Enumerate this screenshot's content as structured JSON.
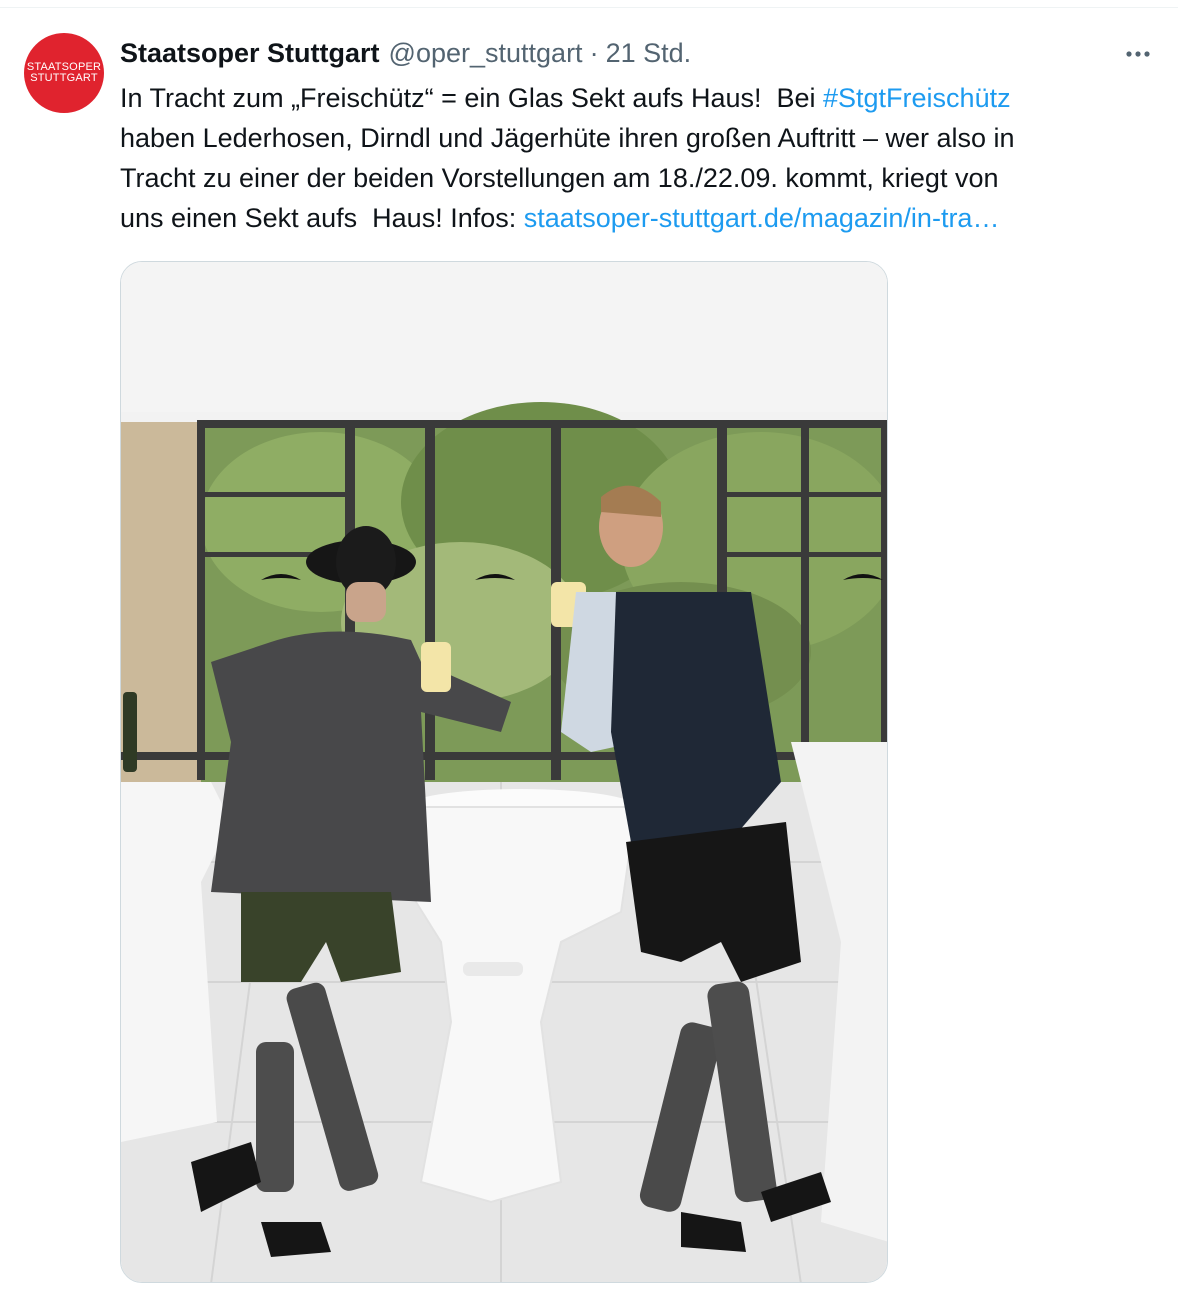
{
  "tweet": {
    "author_name": "Staatsoper Stuttgart",
    "handle": "@oper_stuttgart",
    "separator": "·",
    "time": "21 Std.",
    "more_icon": "more-horizontal-icon",
    "avatar": {
      "line1": "STAATSOPER",
      "line2": "STUTTGART",
      "color": "#e0232e"
    },
    "text_part1": "In Tracht zum „Freischütz“ = ein Glas Sekt aufs Haus!  Bei ",
    "hashtag": "#StgtFreischütz",
    "text_part2": "\nhaben Lederhosen, Dirndl und Jägerhüte ihren großen Auftritt – wer also in\nTracht zu einer der beiden Vorstellungen am 18./22.09. kommt, kriegt von\nuns einen Sekt aufs  Haus! Infos: ",
    "link": "staatsoper-stuttgart.de/magazin/in-tra…",
    "link_color": "#1d9bf0"
  }
}
